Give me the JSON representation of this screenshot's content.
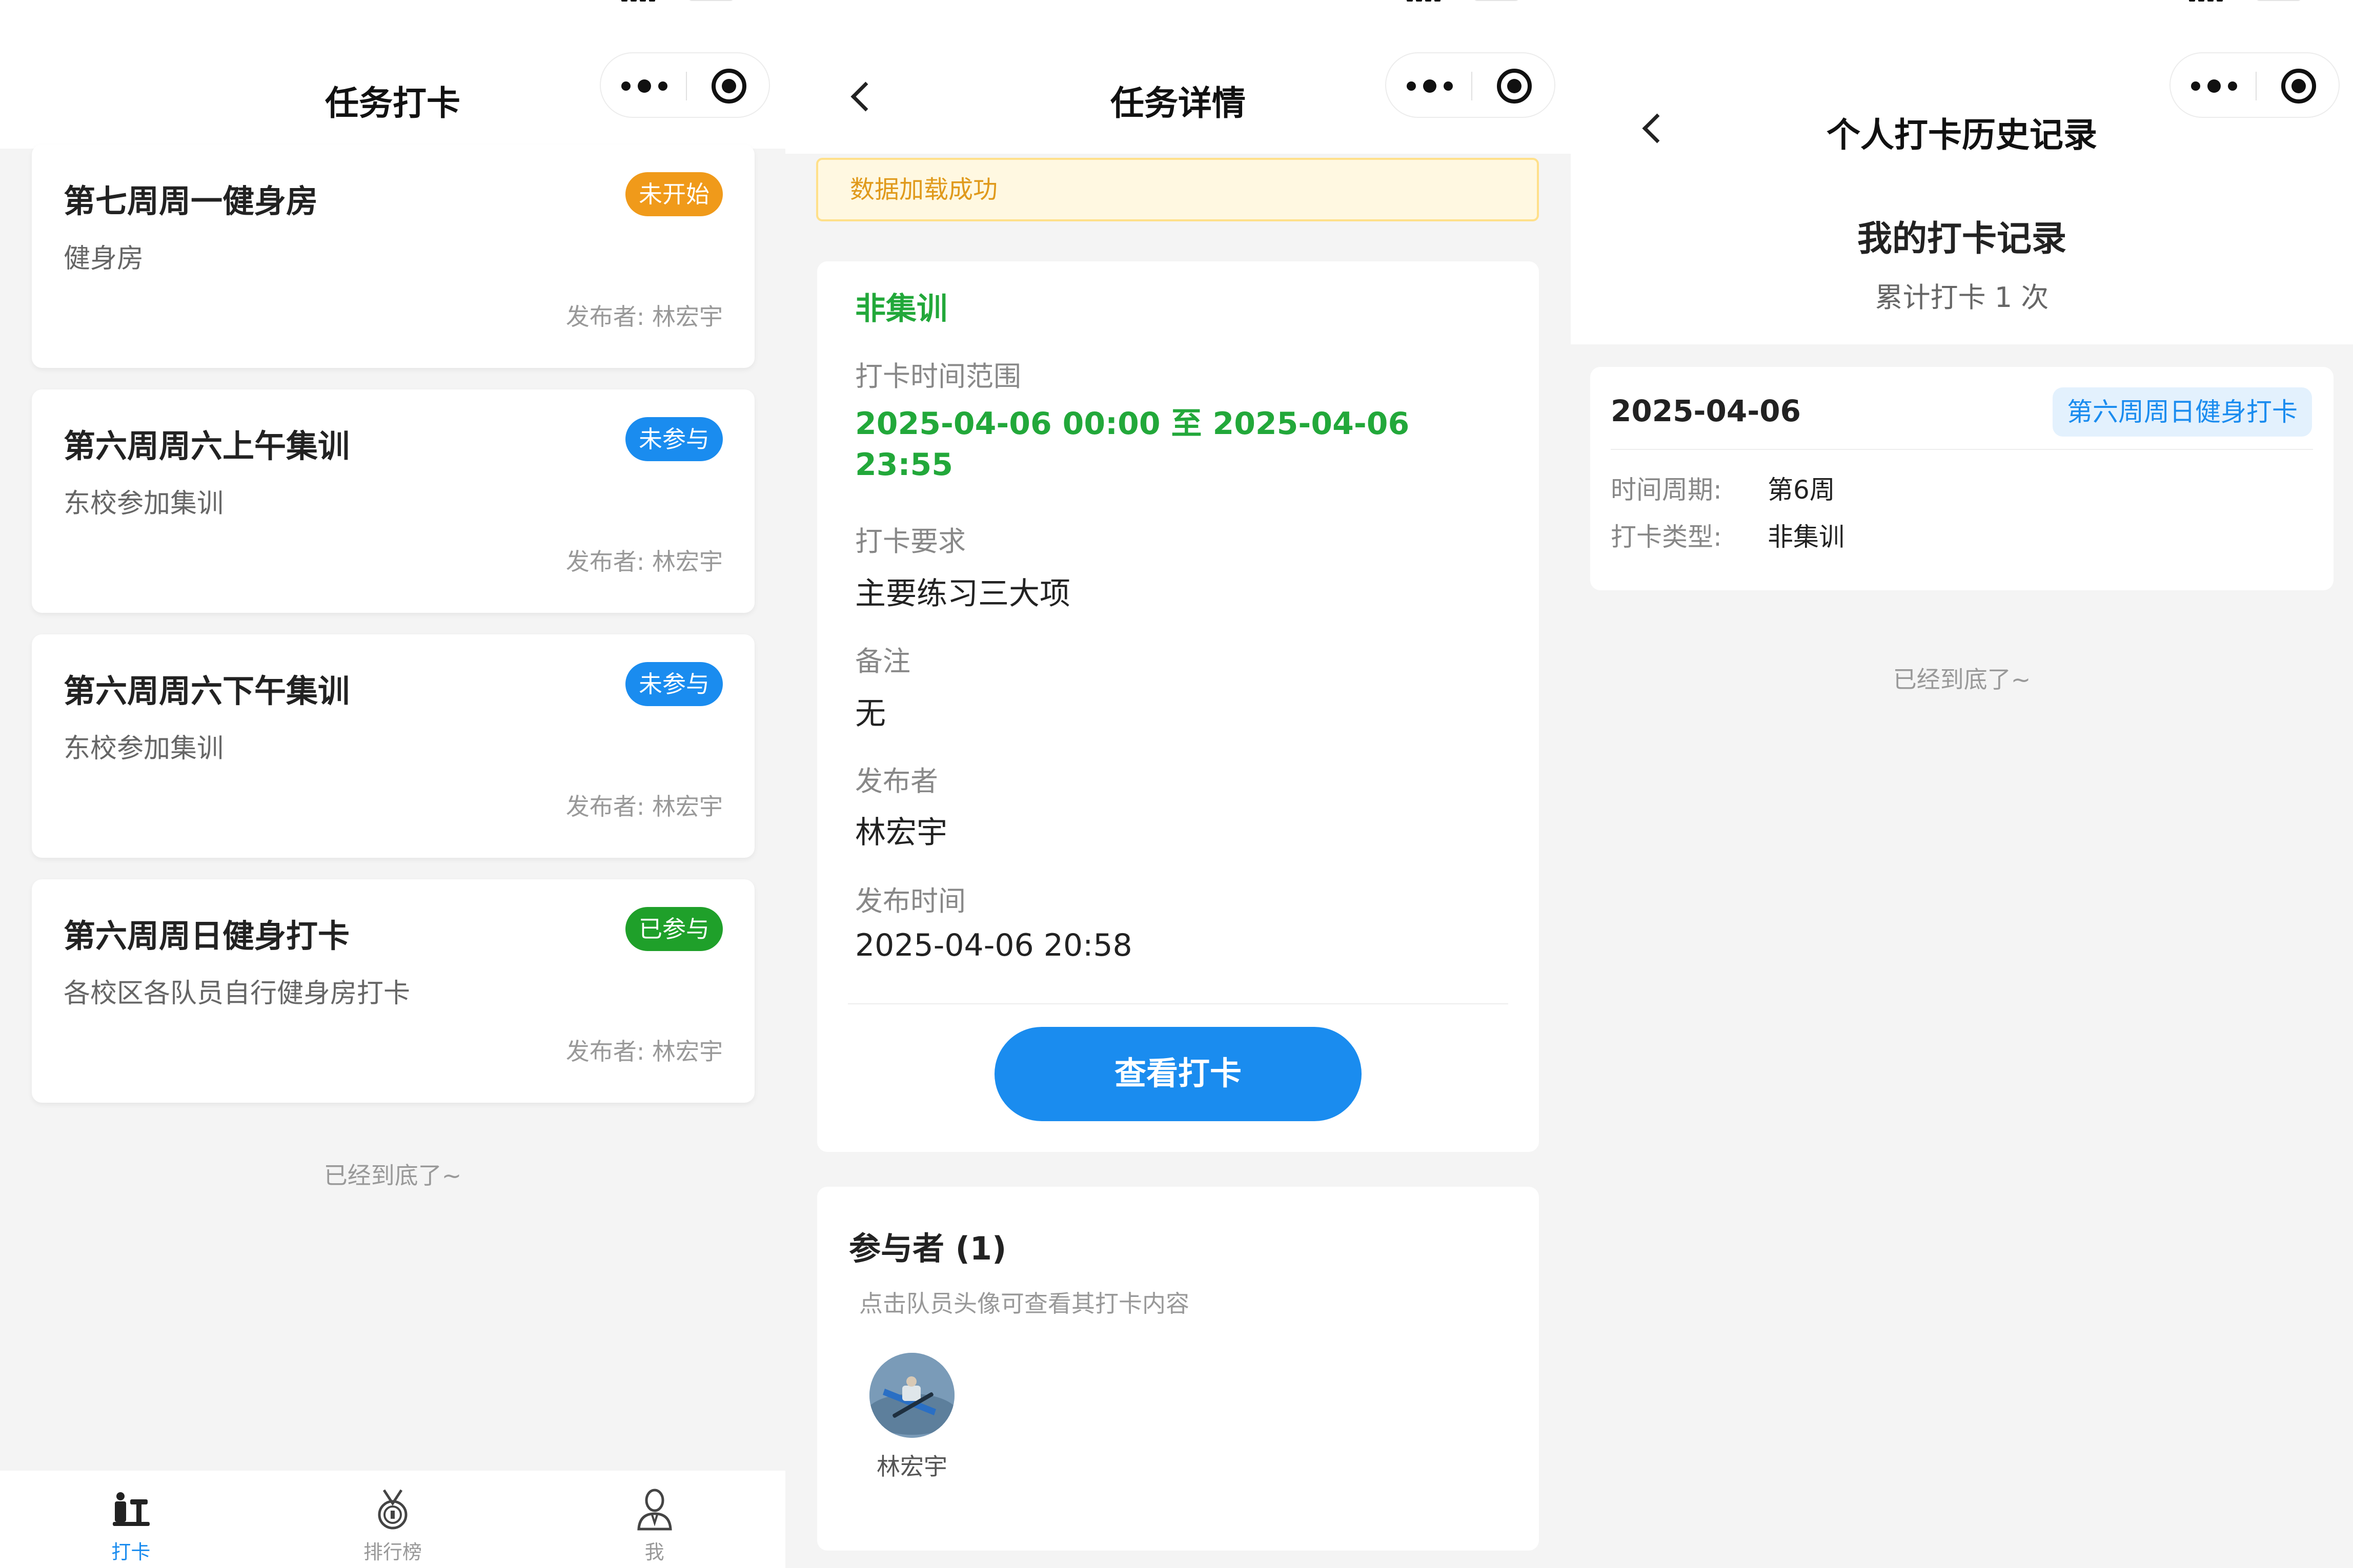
{
  "screen_list": {
    "nav_title": "任务打卡",
    "tasks": [
      {
        "title": "第七周周一健身房",
        "desc": "健身房",
        "publisher": "发布者: 林宏宇",
        "status": "未开始",
        "status_color": "#f09a1a"
      },
      {
        "title": "第六周周六上午集训",
        "desc": "东校参加集训",
        "publisher": "发布者: 林宏宇",
        "status": "未参与",
        "status_color": "#1a8cef"
      },
      {
        "title": "第六周周六下午集训",
        "desc": "东校参加集训",
        "publisher": "发布者: 林宏宇",
        "status": "未参与",
        "status_color": "#1a8cef"
      },
      {
        "title": "第六周周日健身打卡",
        "desc": "各校区各队员自行健身房打卡",
        "publisher": "发布者: 林宏宇",
        "status": "已参与",
        "status_color": "#1fa02a"
      }
    ],
    "end_hint": "已经到底了~",
    "tabs": [
      {
        "label": "打卡",
        "icon": "checkin-icon",
        "active": true
      },
      {
        "label": "排行榜",
        "icon": "medal-icon",
        "active": false
      },
      {
        "label": "我",
        "icon": "person-icon",
        "active": false
      }
    ]
  },
  "screen_detail": {
    "nav_title": "任务详情",
    "toast": "数据加载成功",
    "type_value": "非集训",
    "time_range_label": "打卡时间范围",
    "time_range_line1": "2025-04-06 00:00 至 2025-04-06",
    "time_range_line2": "23:55",
    "requirement_label": "打卡要求",
    "requirement_value": "主要练习三大项",
    "remark_label": "备注",
    "remark_value": "无",
    "publisher_label": "发布者",
    "publisher_value": "林宏宇",
    "publish_time_label": "发布时间",
    "publish_time_value": "2025-04-06 20:58",
    "button_label": "查看打卡",
    "participants_title": "参与者 (1)",
    "participants_hint": "点击队员头像可查看其打卡内容",
    "participants": [
      {
        "name": "林宏宇"
      }
    ]
  },
  "screen_history": {
    "nav_title": "个人打卡历史记录",
    "summary_title": "我的打卡记录",
    "summary_count": "累计打卡 1 次",
    "records": [
      {
        "date": "2025-04-06",
        "tag": "第六周周日健身打卡",
        "period_label": "时间周期:",
        "period_value": "第6周",
        "type_label": "打卡类型:",
        "type_value": "非集训"
      }
    ],
    "end_hint": "已经到底了~"
  },
  "colors": {
    "primary": "#1a8cef",
    "success_green": "#22a83a",
    "toast_text": "#e09a1c"
  }
}
